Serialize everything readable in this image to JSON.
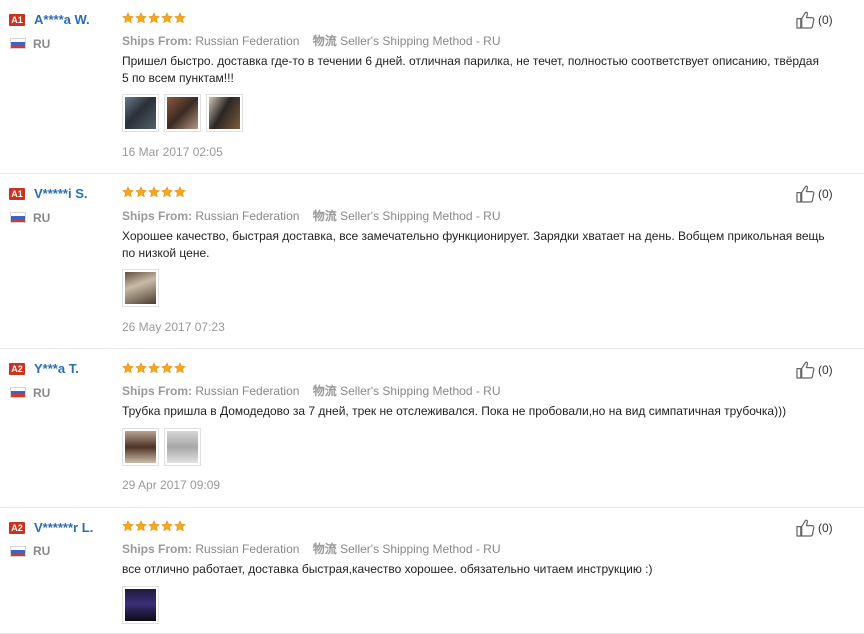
{
  "accent_colors": {
    "username": "#2a6db5",
    "badge": "#c8341f",
    "star": "#f5a623"
  },
  "ships_from_label": "Ships From:",
  "shipping_method_label": "物流",
  "reviews": [
    {
      "badge": "A1",
      "username": "A****a W.",
      "country": "RU",
      "rating": 5,
      "likes": "(0)",
      "ships_from": "Russian Federation",
      "shipping_method": "Seller's Shipping Method - RU",
      "text": "Пришел быстро. доставка где-то в течении 6 дней. отличная парилка, не течет, полностью соответствует описанию, твёрдая 5 по всем пунктам!!!",
      "photo_count": 3,
      "date": "16 Mar 2017 02:05"
    },
    {
      "badge": "A1",
      "username": "V*****i S.",
      "country": "RU",
      "rating": 5,
      "likes": "(0)",
      "ships_from": "Russian Federation",
      "shipping_method": "Seller's Shipping Method - RU",
      "text": "Хорошее качество, быстрая доставка, все замечательно функционирует. Зарядки хватает на день. Вобщем прикольная вещь по низкой цене.",
      "photo_count": 1,
      "date": "26 May 2017 07:23"
    },
    {
      "badge": "A2",
      "username": "Y***a T.",
      "country": "RU",
      "rating": 5,
      "likes": "(0)",
      "ships_from": "Russian Federation",
      "shipping_method": "Seller's Shipping Method - RU",
      "text": "Трубка пришла в Домодедово за 7 дней, трек не отслеживался. Пока не пробовали,но на вид симпатичная трубочка)))",
      "photo_count": 2,
      "date": "29 Apr 2017 09:09"
    },
    {
      "badge": "A2",
      "username": "V******r L.",
      "country": "RU",
      "rating": 5,
      "likes": "(0)",
      "ships_from": "Russian Federation",
      "shipping_method": "Seller's Shipping Method - RU",
      "text": "все отлично работает, доставка быстрая,качество хорошее. обязательно читаем инструкцию :)",
      "photo_count": 1,
      "date": ""
    }
  ]
}
